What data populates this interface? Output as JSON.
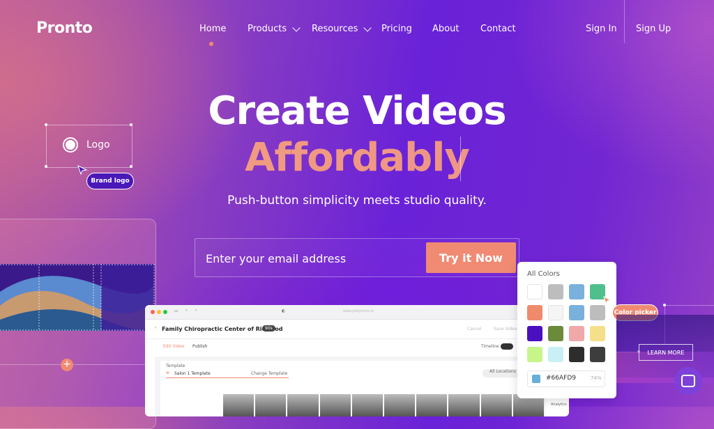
{
  "nav": {
    "logo": "Pronto",
    "items": [
      "Home",
      "Products",
      "Resources",
      "Pricing",
      "About",
      "Contact"
    ],
    "sign_in": "Sign In",
    "sign_up": "Sign Up"
  },
  "hero": {
    "line1": "Create Videos",
    "line2": "Affordably",
    "subtitle": "Push-button simplicity meets studio quality."
  },
  "signup": {
    "placeholder": "Enter your email address",
    "button": "Try it Now"
  },
  "logo_widget": {
    "label": "Logo",
    "tag": "Brand logo"
  },
  "app_mock": {
    "title": "Family Chiropractic Center of Richmod",
    "badge": "90s",
    "url": "www.getpronto.io",
    "cancel": "Cancel",
    "save": "Save Video",
    "tabs": [
      "Edit Video",
      "Publish"
    ],
    "timeline": "Timeline",
    "template_label": "Template",
    "template_value": "Salon 1 Template",
    "change_template": "Change Template",
    "locations": "All Locations",
    "analytics": "Analytics"
  },
  "color_picker": {
    "title": "All Colors",
    "swatches": [
      "#ffffff",
      "#bdbdbd",
      "#7ab0dc",
      "#4fc08d",
      "#ef8a6c",
      "#f5f5f5",
      "#7ab0dc",
      "#bdbdbd",
      "#4a10c0",
      "#6b8a3a",
      "#f0a8a8",
      "#f5e08a",
      "#c6f58a",
      "#c8f0f5",
      "#2d2d2d",
      "#3d3d3d"
    ],
    "hex": "#66AFD9",
    "percent": "74%",
    "tag": "Color picker"
  },
  "learn_more": "LEARN MORE",
  "colors": {
    "accent": "#f08a73",
    "brand_purple": "#6a22d8"
  }
}
